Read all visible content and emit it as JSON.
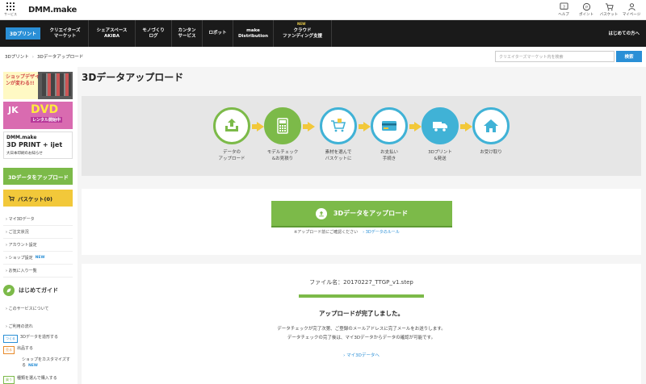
{
  "topbar": {
    "services_label": "サービス",
    "logo_text": "DMM.make",
    "icons": [
      {
        "name": "help-icon",
        "label": "ヘルプ"
      },
      {
        "name": "point-icon",
        "label": "ポイント"
      },
      {
        "name": "basket-icon",
        "label": "バスケット"
      },
      {
        "name": "mypage-icon",
        "label": "マイページ"
      }
    ]
  },
  "nav": {
    "active": "3Dプリント",
    "items": [
      {
        "label1": "クリエイターズ",
        "label2": "マーケット"
      },
      {
        "label1": "シェアスペース",
        "label2": "AKIBA"
      },
      {
        "label1": "モノづくり",
        "label2": "ログ"
      },
      {
        "label1": "カンタン",
        "label2": "サービス"
      },
      {
        "label1": "ロボット",
        "label2": ""
      },
      {
        "label1": "make",
        "label2": "Distribution"
      },
      {
        "label1": "クラウド",
        "label2": "ファンディング支援"
      }
    ],
    "new_tag": "NEW",
    "first_time": "はじめての方へ"
  },
  "breadcrumb": {
    "home": "3Dプリント",
    "current": "3Dデータアップロード"
  },
  "search": {
    "placeholder": "クリエイターズマーケット内を検索",
    "button": "検索"
  },
  "sidebar": {
    "banner1_text": "ショップデザインが変わる!!",
    "banner2": {
      "dvd": "DVD",
      "jk": "JK",
      "sub": "レンタル開始中"
    },
    "banner3": {
      "line1": "DMM.make",
      "line2": "3D PRINT + ijet",
      "line3": "大日本印刷のお知らせ"
    },
    "upload_button": "3Dデータをアップロード",
    "basket_button": "バスケット(0)",
    "links": [
      {
        "label": "マイ3Dデータ",
        "new": ""
      },
      {
        "label": "ご注文状況",
        "new": ""
      },
      {
        "label": "アカウント設定",
        "new": ""
      },
      {
        "label": "ショップ設定",
        "new": "NEW"
      },
      {
        "label": "お気に入り一覧",
        "new": ""
      }
    ],
    "guide_title": "はじめてガイド",
    "guide_about": "このサービスについて",
    "guide_flow": "ご利用の流れ",
    "guide_steps": [
      {
        "tag": "つくる",
        "text": "3Dデータを造形する",
        "new": ""
      },
      {
        "tag": "売る",
        "text": "出品する",
        "new": ""
      },
      {
        "tag": "",
        "text": "ショップをカスタマイズする",
        "new": "NEW"
      },
      {
        "tag": "買う",
        "text": "種類を選んで購入する",
        "new": ""
      }
    ]
  },
  "main": {
    "title": "3Dデータアップロード",
    "flow_steps": [
      {
        "icon": "upload-tray-icon",
        "line1": "データの",
        "line2": "アップロード"
      },
      {
        "icon": "calculator-icon",
        "line1": "モデルチェック",
        "line2": "&お見積り"
      },
      {
        "icon": "cart-icon",
        "line1": "素材を選んで",
        "line2": "バスケットに"
      },
      {
        "icon": "credit-card-icon",
        "line1": "お支払い",
        "line2": "手続き"
      },
      {
        "icon": "truck-icon",
        "line1": "3Dプリント",
        "line2": "&発送"
      },
      {
        "icon": "house-icon",
        "line1": "お受け取り",
        "line2": ""
      }
    ],
    "upload_button": "3Dデータをアップロード",
    "note_text": "※アップロード前にご確認ください",
    "note_link": "3Dデータのルール",
    "file_name": "ファイル名：20170227_TTGP_v1.step",
    "progress": 1.0,
    "complete_text": "アップロードが完了しました。",
    "message_line1": "データチェックが完了次第、ご登録のメールアドレスに完了メールをお送りします。",
    "message_line2": "データチェックの完了後は、マイ3Dデータからデータの確認が可能です。",
    "my3d_link": "マイ3Dデータへ"
  },
  "colors": {
    "green": "#7cba49",
    "blue": "#2a8fd6",
    "cyan": "#40b2d6",
    "yellow": "#f2c83a",
    "nav_bg": "#1a1a1a"
  }
}
